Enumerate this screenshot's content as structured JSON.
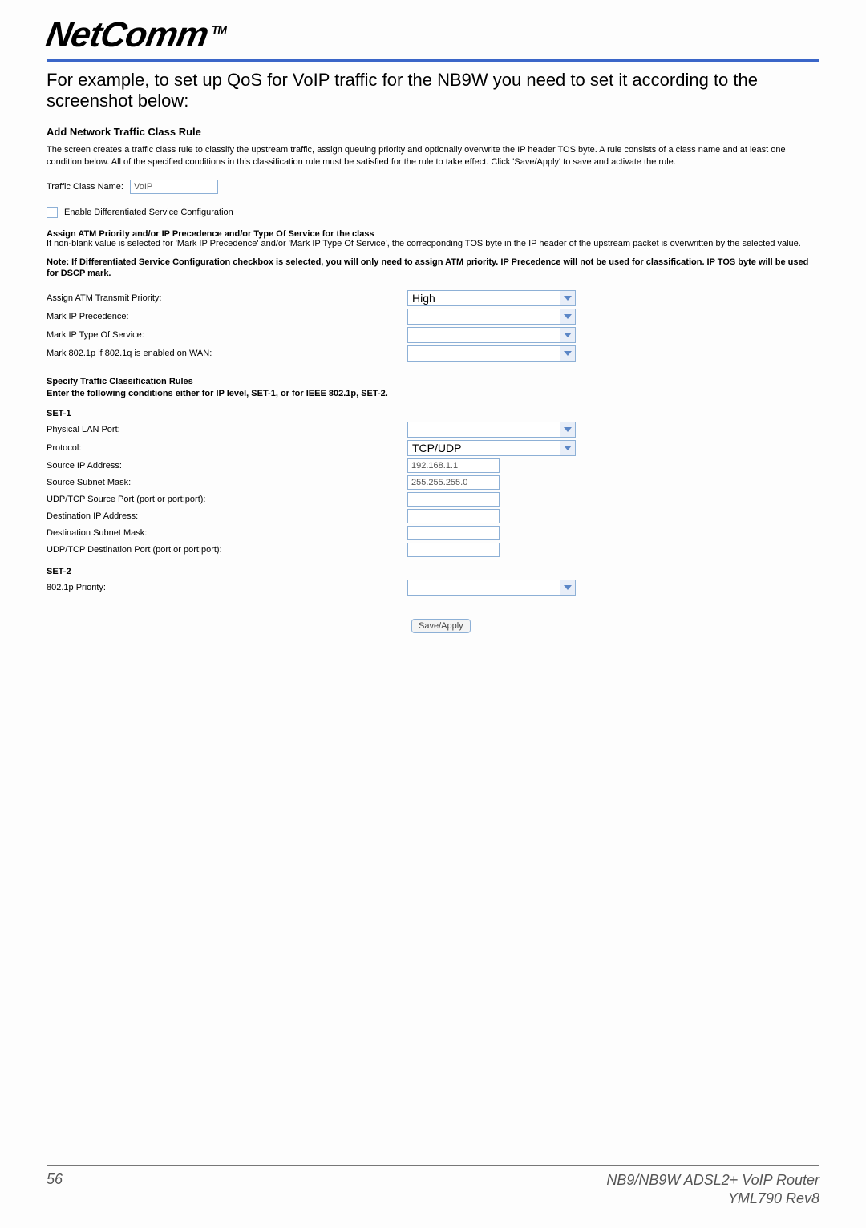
{
  "brand": {
    "name": "NetComm",
    "tm": "TM"
  },
  "intro": "For example, to set up QoS for VoIP traffic for the NB9W you need to set it according to the screenshot below:",
  "sections": {
    "add_rule_title": "Add Network Traffic Class Rule",
    "add_rule_text": "The screen creates a traffic class rule to classify the upstream traffic, assign queuing priority and optionally overwrite the IP header TOS byte. A rule consists of a class name and at least one condition below. All of the specified conditions in this classification rule must be satisfied for the rule to take effect. Click 'Save/Apply' to save and activate the rule.",
    "traffic_class_label": "Traffic Class Name:",
    "traffic_class_value": "VoIP",
    "enable_dsc_label": "Enable Differentiated Service Configuration",
    "assign_title": "Assign ATM Priority and/or IP Precedence and/or Type Of Service for the class",
    "assign_text": "If non-blank value is selected for 'Mark IP Precedence' and/or 'Mark IP Type Of Service', the correcponding TOS byte in the IP header of the upstream packet is overwritten by the selected value.",
    "note_text": "Note: If Differentiated Service Configuration checkbox is selected, you will only need to assign ATM priority. IP Precedence will not be used for classification. IP TOS byte will be used for DSCP mark.",
    "priority": {
      "atm_label": "Assign ATM Transmit Priority:",
      "atm_value": "High",
      "ipprec_label": "Mark IP Precedence:",
      "ipprec_value": "",
      "iptos_label": "Mark IP Type Of Service:",
      "iptos_value": "",
      "dot1p_label": "Mark 802.1p if 802.1q is enabled on WAN:",
      "dot1p_value": ""
    },
    "classify_title": "Specify Traffic Classification Rules",
    "classify_sub": "Enter the following conditions either for IP level, SET-1, or for IEEE 802.1p, SET-2.",
    "set1": {
      "title": "SET-1",
      "lan_label": "Physical LAN Port:",
      "lan_value": "",
      "proto_label": "Protocol:",
      "proto_value": "TCP/UDP",
      "srcip_label": "Source IP Address:",
      "srcip_value": "192.168.1.1",
      "srcmask_label": "Source Subnet Mask:",
      "srcmask_value": "255.255.255.0",
      "srcport_label": "UDP/TCP Source Port (port or port:port):",
      "srcport_value": "",
      "dstip_label": "Destination IP Address:",
      "dstip_value": "",
      "dstmask_label": "Destination Subnet Mask:",
      "dstmask_value": "",
      "dstport_label": "UDP/TCP Destination Port (port or port:port):",
      "dstport_value": ""
    },
    "set2": {
      "title": "SET-2",
      "dot1p_label": "802.1p Priority:",
      "dot1p_value": ""
    },
    "save_label": "Save/Apply"
  },
  "footer": {
    "page": "56",
    "product": "NB9/NB9W ADSL2+ VoIP Router",
    "doc": "YML790 Rev8"
  }
}
